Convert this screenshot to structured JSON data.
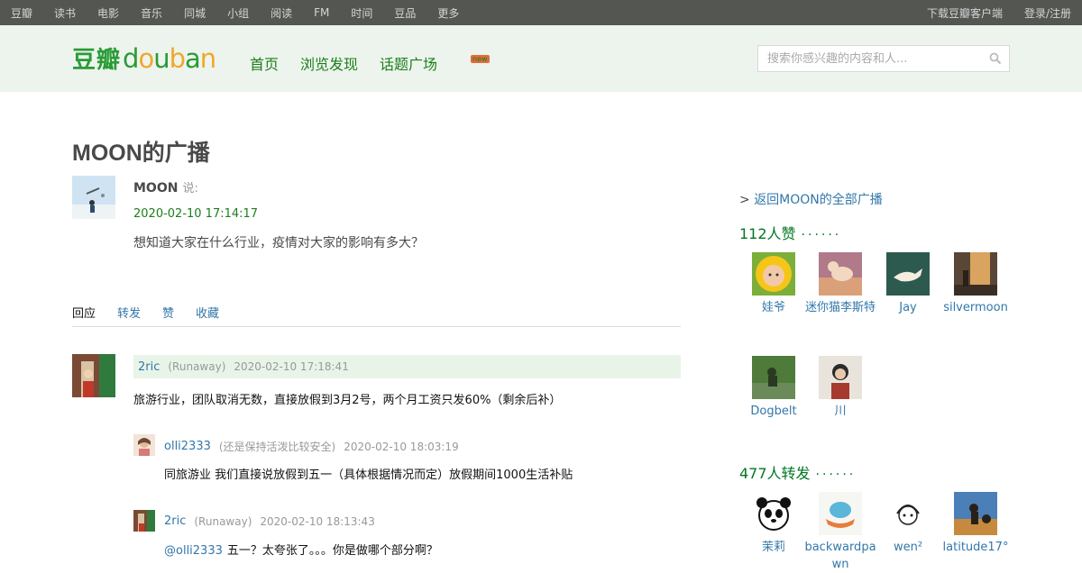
{
  "topnav": {
    "left": [
      "豆瓣",
      "读书",
      "电影",
      "音乐",
      "同城",
      "小组",
      "阅读",
      "FM",
      "时间",
      "豆品",
      "更多"
    ],
    "right": [
      "下载豆瓣客户端",
      "登录/注册"
    ]
  },
  "header": {
    "logo_cn": "豆瓣",
    "logo_en": "douban",
    "nav": [
      "首页",
      "浏览发现",
      "话题广场"
    ],
    "new_badge": "new",
    "search_placeholder": "搜索你感兴趣的内容和人...",
    "search_icon": "search-icon"
  },
  "status": {
    "page_title": "MOON的广播",
    "author": "MOON",
    "says": "说:",
    "time": "2020-02-10 17:14:17",
    "text": "想知道大家在什么行业，疫情对大家的影响有多大？"
  },
  "tabs": [
    "回应",
    "转发",
    "赞",
    "收藏"
  ],
  "comments": {
    "main": {
      "user": "2ric",
      "meta": "(Runaway)",
      "time": "2020-02-10 17:18:41",
      "text": "旅游行业，团队取消无数，直接放假到3月2号，两个月工资只发60%（剩余后补）"
    },
    "replies": [
      {
        "user": "olli2333",
        "meta": "(还是保持活泼比较安全)",
        "time": "2020-02-10 18:03:19",
        "mention": "",
        "text": "同旅游业 我们直接说放假到五一（具体根据情况而定）放假期间1000生活补贴"
      },
      {
        "user": "2ric",
        "meta": "(Runaway)",
        "time": "2020-02-10 18:13:43",
        "mention": "@olli2333",
        "text": "五一？太夸张了。。。你是做哪个部分啊？"
      }
    ]
  },
  "sidebar": {
    "back_link": "返回MOON的全部广播",
    "back_prefix": ">",
    "likes_title": "112人赞",
    "reshares_title": "477人转发",
    "dots": "······",
    "likers": [
      "娃爷",
      "迷你猫李斯特",
      "Jay",
      "silvermoon",
      "Dogbelt",
      "川"
    ],
    "resharers": [
      "茉莉",
      "backwardpawn",
      "wen²",
      "latitude17°"
    ]
  },
  "colors": {
    "topbar": "#545652",
    "header_bg": "#edf4ed",
    "brand_green": "#2a9b37",
    "link_blue": "#3377aa",
    "reply_head_bg": "#e9f4e9"
  }
}
